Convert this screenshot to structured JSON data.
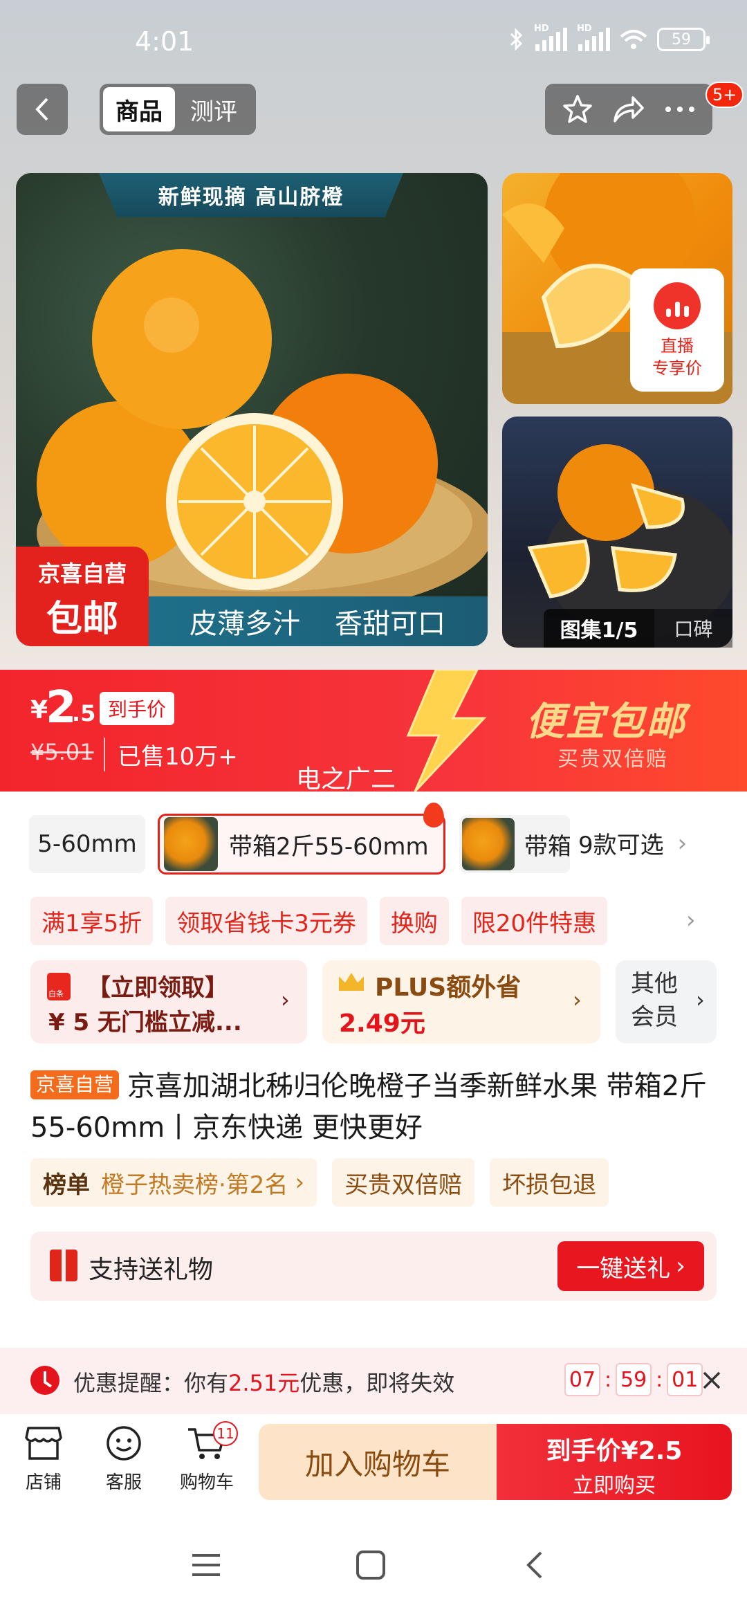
{
  "status_bar": {
    "time": "4:01",
    "battery": "59",
    "signal_tag": "HD"
  },
  "header": {
    "tabs": [
      "商品",
      "测评"
    ],
    "message_badge": "5+"
  },
  "gallery": {
    "main_banner": "新鲜现摘 高山脐橙",
    "main_slogan_a": "皮薄多汁",
    "main_slogan_b": "香甜可口",
    "badge_line1": "京喜自营",
    "badge_line2": "包邮",
    "live_line1": "直播",
    "live_line2": "专享价",
    "album_label": "图集1/5",
    "reviews_label": "口碑"
  },
  "price": {
    "currency": "¥",
    "integer": "2",
    "decimal": ".5",
    "price_tag": "到手价",
    "original": "¥5.01",
    "sold": "已售10万+",
    "promo_title": "便宜包邮",
    "promo_sub": "买贵双倍赔",
    "watermark": "电之广二"
  },
  "variants": {
    "cut_label": "5-60mm",
    "selected": "带箱2斤55-60mm",
    "third": "带箱",
    "more": "9款可选"
  },
  "coupons": [
    "满1享5折",
    "领取省钱卡3元券",
    "换购",
    "限20件特惠"
  ],
  "cards": {
    "red_tag": "白条",
    "left_title": "【立即领取】",
    "left_sub": "¥ 5 无门槛立减...",
    "mid_title": "PLUS额外省",
    "mid_sub": "2.49元",
    "right_title": "其他会员"
  },
  "product": {
    "badge": "京喜自营",
    "title": "京喜加湖北秭归伦晚橙子当季新鲜水果 带箱2斤55-60mm丨京东快递 更快更好",
    "rank_label": "榜单",
    "rank_value": "橙子热卖榜·第2名",
    "tag1": "买贵双倍赔",
    "tag2": "坏损包退"
  },
  "gift": {
    "label": "支持送礼物",
    "button": "一键送礼"
  },
  "reminder": {
    "prefix": "优惠提醒：你有",
    "amount": "2.51元",
    "suffix": "优惠，即将失效",
    "h": "07",
    "m": "59",
    "s": "01"
  },
  "bottom_bar": {
    "shop": "店铺",
    "service": "客服",
    "cart": "购物车",
    "cart_count": "11",
    "add_cart": "加入购物车",
    "buy_line1": "到手价¥2.5",
    "buy_line2": "立即购买"
  },
  "colors": {
    "accent_red": "#e8141f",
    "price_bar": "#f2252b",
    "promo_gold": "#ffd98a"
  }
}
